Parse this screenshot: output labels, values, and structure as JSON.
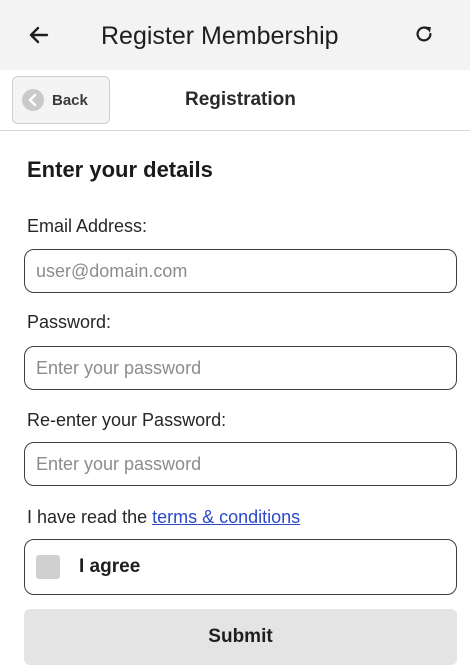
{
  "app_bar": {
    "title": "Register Membership",
    "back_icon": "arrow-left-icon",
    "refresh_icon": "refresh-icon"
  },
  "sub_header": {
    "back_label": "Back",
    "title": "Registration"
  },
  "form": {
    "heading": "Enter your details",
    "email": {
      "label": "Email Address:",
      "value": "",
      "placeholder": "user@domain.com"
    },
    "password": {
      "label": "Password:",
      "value": "",
      "placeholder": "Enter your password"
    },
    "password_confirm": {
      "label": "Re-enter your Password:",
      "value": "",
      "placeholder": "Enter your password"
    },
    "terms": {
      "prefix": "I have read the ",
      "link_text": "terms & conditions"
    },
    "agree": {
      "label": "I agree",
      "checked": false
    },
    "submit_label": "Submit"
  },
  "colors": {
    "link": "#2b49c9",
    "app_bar_bg": "#f3f3f3",
    "submit_bg": "#e4e4e4",
    "checkbox": "#d0d0d0"
  }
}
